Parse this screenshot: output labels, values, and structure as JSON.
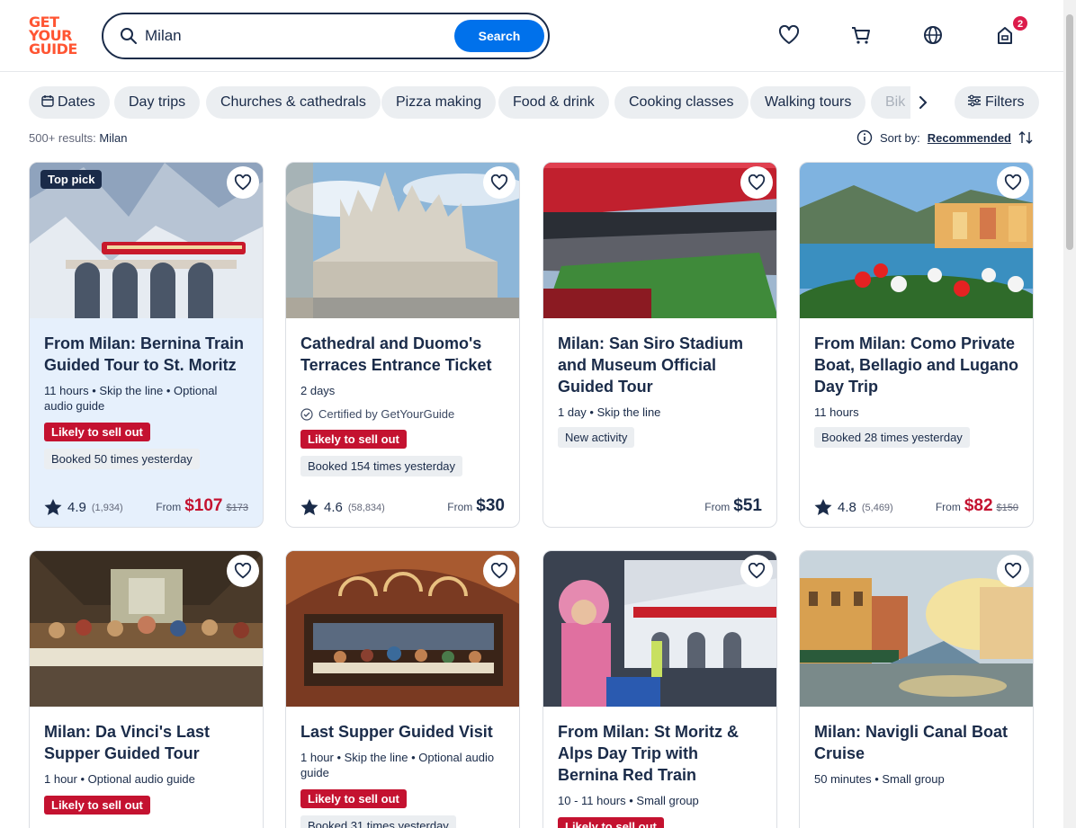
{
  "header": {
    "logo_lines": [
      "GET",
      "YOUR",
      "GUIDE"
    ],
    "search_value": "Milan",
    "search_button": "Search",
    "cart_badge": "2"
  },
  "chips": [
    "Dates",
    "Day trips",
    "Churches & cathedrals",
    "Pizza making",
    "Food & drink",
    "Cooking classes",
    "Walking tours",
    "Bik",
    "Filters"
  ],
  "results": {
    "count": "500+ results:",
    "query": "Milan",
    "sort_label": "Sort by:",
    "sort_value": "Recommended"
  },
  "cards": [
    {
      "badge": "Top pick",
      "title": "From Milan: Bernina Train Guided Tour to St. Moritz",
      "meta": "11 hours • Skip the line • Optional audio guide",
      "sellout": "Likely to sell out",
      "booked": "Booked 50 times yesterday",
      "rating": "4.9",
      "reviews": "(1,934)",
      "from": "From",
      "price": "$107",
      "old_price": "$173"
    },
    {
      "title": "Cathedral and Duomo's Terraces Entrance Ticket",
      "meta": "2 days",
      "certified": "Certified by GetYourGuide",
      "sellout": "Likely to sell out",
      "booked": "Booked 154 times yesterday",
      "rating": "4.6",
      "reviews": "(58,834)",
      "from": "From",
      "price": "$30"
    },
    {
      "title": "Milan: San Siro Stadium and Museum Official Guided Tour",
      "meta": "1 day • Skip the line",
      "new_activity": "New activity",
      "from": "From",
      "price": "$51"
    },
    {
      "title": "From Milan: Como Private Boat, Bellagio and Lugano Day Trip",
      "meta": "11 hours",
      "booked": "Booked 28 times yesterday",
      "rating": "4.8",
      "reviews": "(5,469)",
      "from": "From",
      "price": "$82",
      "old_price": "$150"
    },
    {
      "title": "Milan: Da Vinci's Last Supper Guided Tour",
      "meta": "1 hour • Optional audio guide",
      "sellout": "Likely to sell out"
    },
    {
      "title": "Last Supper Guided Visit",
      "meta": "1 hour • Skip the line • Optional audio guide",
      "sellout": "Likely to sell out",
      "booked": "Booked 31 times yesterday"
    },
    {
      "title": "From Milan: St Moritz & Alps Day Trip with Bernina Red Train",
      "meta": "10 - 11 hours • Small group",
      "sellout": "Likely to sell out"
    },
    {
      "title": "Milan: Navigli Canal Boat Cruise",
      "meta": "50 minutes • Small group"
    }
  ],
  "colors": {
    "brand": "#ff5533",
    "primary": "#0071eb",
    "sale": "#c41230",
    "text": "#1a2b49"
  }
}
